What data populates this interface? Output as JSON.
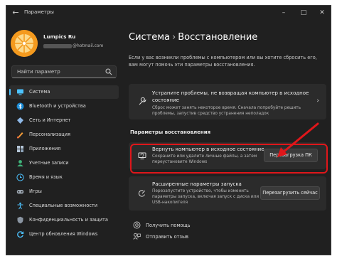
{
  "window": {
    "title": "Параметры",
    "back_icon": "back-arrow-icon",
    "controls": [
      "–",
      "□",
      "✕"
    ]
  },
  "user": {
    "name": "Lumpics Ru",
    "email_suffix": "@hotmail.com"
  },
  "search": {
    "placeholder": "Найти параметр"
  },
  "sidebar": {
    "items": [
      {
        "label": "Система",
        "icon": "system-icon",
        "active": true
      },
      {
        "label": "Bluetooth и устройства",
        "icon": "bluetooth-icon"
      },
      {
        "label": "Сеть и Интернет",
        "icon": "network-icon"
      },
      {
        "label": "Персонализация",
        "icon": "personalization-icon"
      },
      {
        "label": "Приложения",
        "icon": "apps-icon"
      },
      {
        "label": "Учетные записи",
        "icon": "accounts-icon"
      },
      {
        "label": "Время и язык",
        "icon": "time-language-icon"
      },
      {
        "label": "Игры",
        "icon": "gaming-icon"
      },
      {
        "label": "Специальные возможности",
        "icon": "accessibility-icon"
      },
      {
        "label": "Конфиденциальность и защита",
        "icon": "privacy-shield-icon"
      },
      {
        "label": "Центр обновления Windows",
        "icon": "windows-update-icon"
      }
    ]
  },
  "main": {
    "breadcrumb_parent": "Система",
    "breadcrumb_sep": "›",
    "breadcrumb_current": "Восстановление",
    "description": "Если у вас возникли проблемы с компьютером или вы хотите сбросить его, вам могут помочь эти параметры восстановления.",
    "fix_card": {
      "title_line1": "Устраните проблемы, не возвращая компьютер в исходное",
      "title_line2": "состояние",
      "sub_line1": "Сброс может занять некоторое время. Сначала попробуйте решить",
      "sub_line2": "проблемы, запустив средство устранения неполадок",
      "chevron": "›"
    },
    "section_title": "Параметры восстановления",
    "reset_card": {
      "title": "Вернуть компьютер в исходное состояние",
      "sub_line1": "Сохраните или удалите личные файлы, а затем",
      "sub_line2": "переустановите Windows",
      "button": "Перезагрузка ПК"
    },
    "advanced_card": {
      "title": "Расширенные параметры запуска",
      "sub_line1": "Перезапустите устройство, чтобы изменить",
      "sub_line2": "параметры запуска, включая запуск с диска или",
      "sub_line3": "USB-накопителя",
      "button": "Перезагрузить сейчас"
    },
    "links": {
      "help": "Получить помощь",
      "feedback": "Отправить отзыв"
    }
  },
  "colors": {
    "accent": "#4cc2ff",
    "highlight": "#e0161a",
    "avatar": "#f49a1e"
  }
}
